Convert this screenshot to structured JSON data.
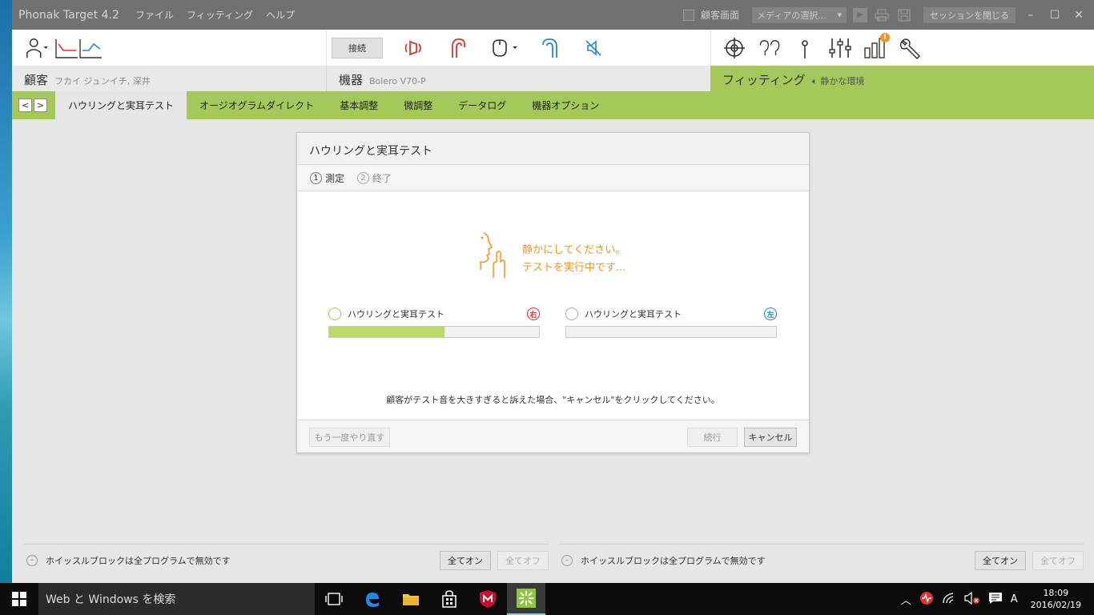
{
  "titlebar": {
    "app_name": "Phonak Target 4.2",
    "menu": [
      "ファイル",
      "フィッティング",
      "ヘルプ"
    ],
    "client_screen_label": "顧客画面",
    "media_select": "メディアの選択...",
    "close_session": "セッションを閉じる"
  },
  "toolbar": {
    "connect_label": "接続",
    "notification_badge": "!"
  },
  "infobar": {
    "client_label": "顧客",
    "client_value": "フカイ ジュンイチ, 深井",
    "device_label": "機器",
    "device_value": "Bolero V70-P",
    "fitting_label": "フィッティング",
    "fitting_value": "静かな環境"
  },
  "tabs": [
    {
      "label": "ハウリングと実耳テスト",
      "active": true
    },
    {
      "label": "オージオグラムダイレクト",
      "active": false
    },
    {
      "label": "基本調整",
      "active": false
    },
    {
      "label": "微調整",
      "active": false
    },
    {
      "label": "データログ",
      "active": false
    },
    {
      "label": "機器オプション",
      "active": false
    }
  ],
  "dialog": {
    "title": "ハウリングと実耳テスト",
    "steps": [
      {
        "num": "1",
        "label": "測定",
        "active": true
      },
      {
        "num": "2",
        "label": "終了",
        "active": false
      }
    ],
    "quiet_line1": "静かにしてください。",
    "quiet_line2": "テストを実行中です...",
    "right_test": {
      "label": "ハウリングと実耳テスト",
      "side": "右",
      "progress": 0.55
    },
    "left_test": {
      "label": "ハウリングと実耳テスト",
      "side": "左",
      "progress": 0.0
    },
    "notice": "顧客がテスト音を大きすぎると訴えた場合、\"キャンセル\"をクリックしてください。",
    "retry_label": "もう一度やり直す",
    "next_label": "続行",
    "cancel_label": "キャンセル"
  },
  "whistle_left": {
    "text": "ホイッスルブロックは全プログラムで無効です",
    "all_on": "全てオン",
    "all_off": "全てオフ"
  },
  "whistle_right": {
    "text": "ホイッスルブロックは全プログラムで無効です",
    "all_on": "全てオン",
    "all_off": "全てオフ"
  },
  "taskbar": {
    "search_placeholder": "Web と Windows を検索",
    "ime": "A",
    "time": "18:09",
    "date": "2016/02/19"
  },
  "colors": {
    "accent_green": "#a4c85a",
    "warning_orange": "#f0961e",
    "right_red": "#dd3333",
    "left_blue": "#2a87c7",
    "titlebar_grey": "#717171"
  }
}
